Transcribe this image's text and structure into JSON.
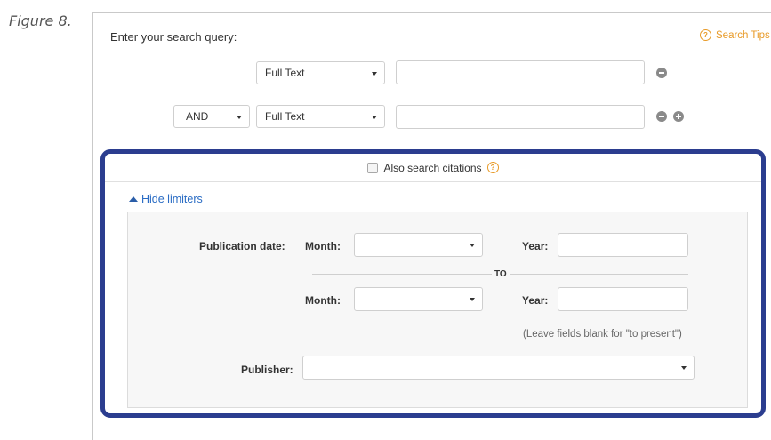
{
  "figure_label": "Figure 8.",
  "search": {
    "title": "Enter your search query:",
    "tips_label": "Search Tips",
    "rows": [
      {
        "field": "Full Text",
        "value": ""
      },
      {
        "operator": "AND",
        "field": "Full Text",
        "value": ""
      }
    ]
  },
  "limiters": {
    "also_search_citations": "Also search citations",
    "hide_limiters": "Hide limiters",
    "publication_date_label": "Publication date:",
    "month_label": "Month:",
    "year_label": "Year:",
    "to_label": "TO",
    "to_present_note": "(Leave fields blank for \"to present\")",
    "publisher_label": "Publisher:"
  },
  "colors": {
    "highlight_border": "#2b3d8f",
    "link": "#2a6cc4",
    "tips_accent": "#e89a27"
  }
}
